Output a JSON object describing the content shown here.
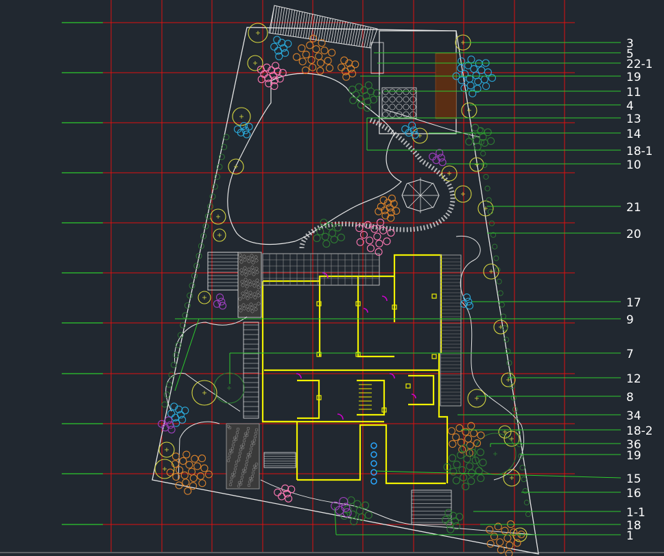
{
  "colors": {
    "background": "#212830",
    "grid": "#e01010",
    "leader": "#2ecc2e",
    "outline": "#e8e8e8",
    "wall": "#f2f200",
    "plant_green": "#2e7d32",
    "plant_orange": "#d9822b",
    "plant_pink": "#ff79b4",
    "plant_blue": "#2aa8d8",
    "plant_purple": "#a040c0",
    "plant_yellow": "#d8d840",
    "door": "#d000d0"
  },
  "callouts": [
    {
      "label": "3"
    },
    {
      "label": "5"
    },
    {
      "label": "22-1"
    },
    {
      "label": "19"
    },
    {
      "label": "11"
    },
    {
      "label": "4"
    },
    {
      "label": "13"
    },
    {
      "label": "14"
    },
    {
      "label": "18-1"
    },
    {
      "label": "10"
    },
    {
      "label": "21"
    },
    {
      "label": "20"
    },
    {
      "label": "17"
    },
    {
      "label": "9"
    },
    {
      "label": "7"
    },
    {
      "label": "12"
    },
    {
      "label": "8"
    },
    {
      "label": "34"
    },
    {
      "label": "18-2"
    },
    {
      "label": "36"
    },
    {
      "label": "19"
    },
    {
      "label": "15"
    },
    {
      "label": "16"
    },
    {
      "label": "1-1"
    },
    {
      "label": "18"
    },
    {
      "label": "1"
    }
  ]
}
